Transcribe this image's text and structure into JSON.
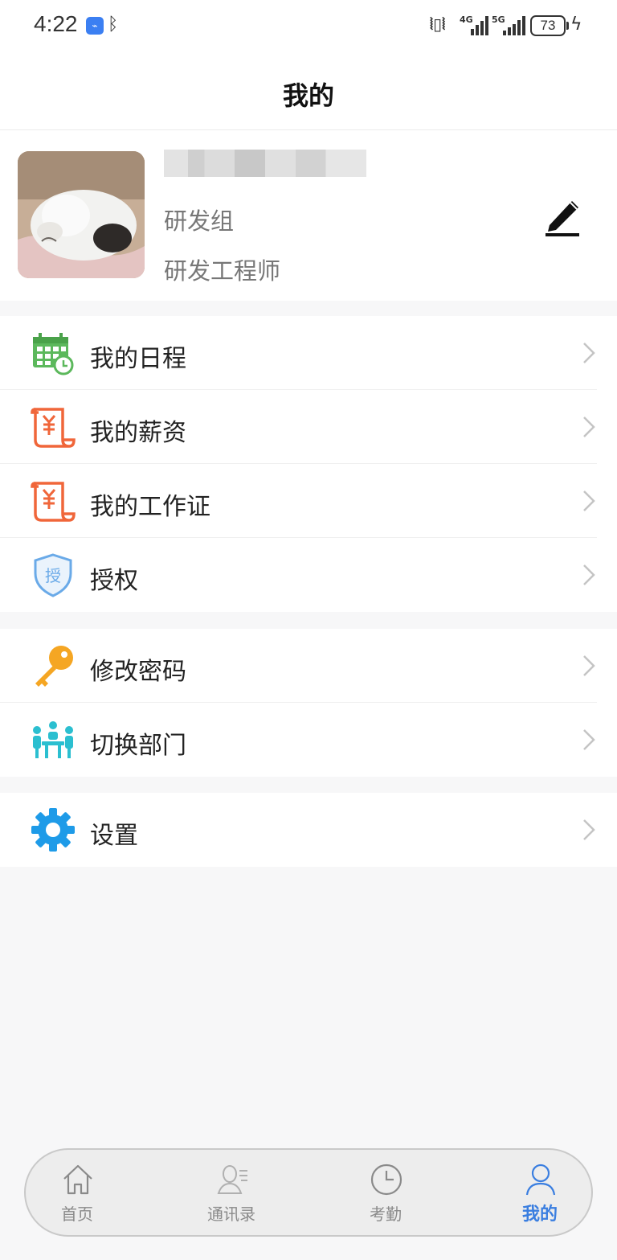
{
  "status_bar": {
    "time": "4:22",
    "usb_icon": "usb-debug-icon",
    "bluetooth_icon": "bluetooth-icon",
    "network_1": "4G",
    "network_2": "5G",
    "battery": "73",
    "charging_icon": "charging-bolt-icon"
  },
  "header": {
    "title": "我的"
  },
  "profile": {
    "name": "██████████",
    "department": "研发组",
    "role": "研发工程师",
    "edit_icon": "pencil-icon"
  },
  "menu_groups": [
    [
      {
        "label": "我的日程",
        "icon": "calendar-clock-icon",
        "color": "#5cb85c"
      },
      {
        "label": "我的薪资",
        "icon": "salary-scroll-icon",
        "color": "#f0663a"
      },
      {
        "label": "我的工作证",
        "icon": "work-badge-scroll-icon",
        "color": "#f0663a"
      },
      {
        "label": "授权",
        "icon": "shield-authorize-icon",
        "color": "#6aaae8"
      }
    ],
    [
      {
        "label": "修改密码",
        "icon": "key-icon",
        "color": "#f5a623"
      },
      {
        "label": "切换部门",
        "icon": "department-switch-icon",
        "color": "#2bbfd0"
      }
    ],
    [
      {
        "label": "设置",
        "icon": "gear-icon",
        "color": "#1e9be8"
      }
    ]
  ],
  "tab_bar": {
    "tabs": [
      {
        "label": "首页",
        "icon": "home-icon"
      },
      {
        "label": "通讯录",
        "icon": "contacts-icon"
      },
      {
        "label": "考勤",
        "icon": "clock-icon"
      },
      {
        "label": "我的",
        "icon": "person-icon",
        "active": true
      }
    ],
    "active_color": "#3a7ee0"
  }
}
